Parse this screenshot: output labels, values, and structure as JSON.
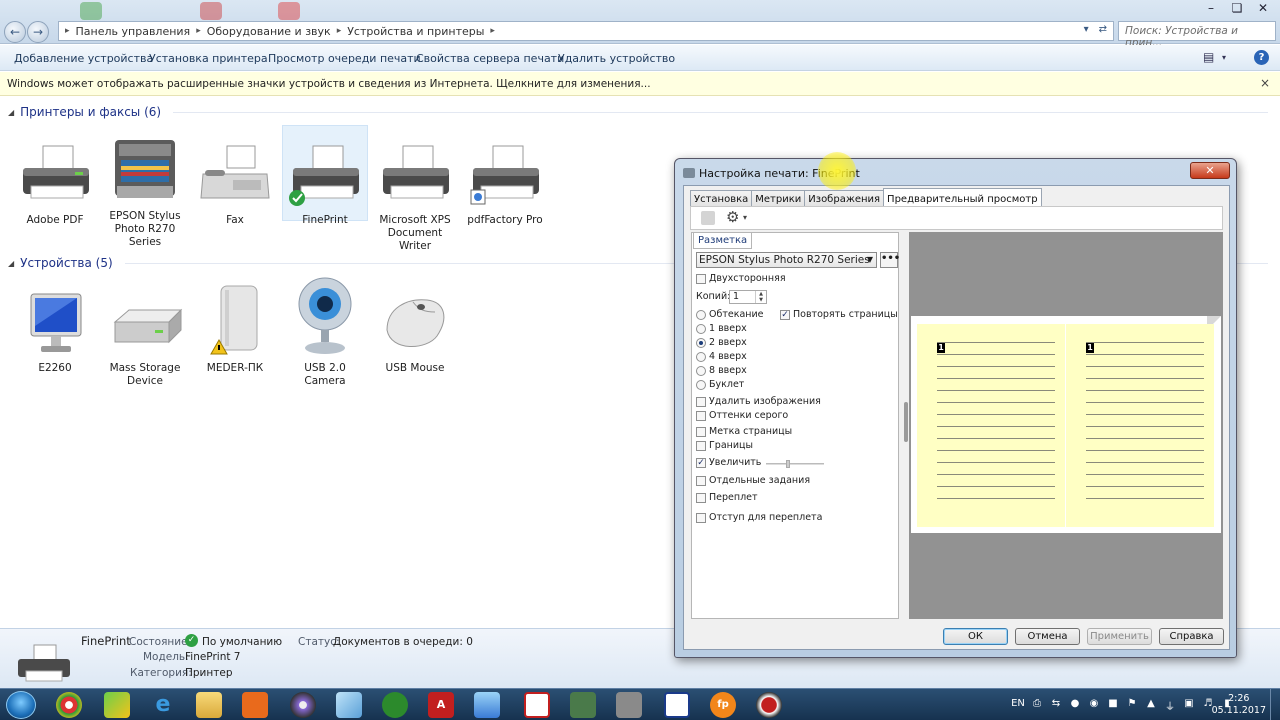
{
  "explorer": {
    "breadcrumbs": [
      "Панель управления",
      "Оборудование и звук",
      "Устройства и принтеры"
    ],
    "search_placeholder": "Поиск: Устройства и прин...",
    "toolbar": [
      "Добавление устройства",
      "Установка принтера",
      "Просмотр очереди печати",
      "Свойства сервера печати",
      "Удалить устройство"
    ],
    "infobar": "Windows может отображать расширенные значки устройств и сведения из Интернета.  Щелкните для изменения..."
  },
  "printers_group": {
    "title": "Принтеры и факсы (6)",
    "items": [
      {
        "label": "Adobe PDF",
        "icon": "printer-icon"
      },
      {
        "label": "EPSON Stylus Photo R270 Series",
        "icon": "inkjet-printer-icon"
      },
      {
        "label": "Fax",
        "icon": "fax-icon"
      },
      {
        "label": "FinePrint",
        "icon": "printer-icon",
        "selected": true,
        "default": true
      },
      {
        "label": "Microsoft XPS Document Writer",
        "icon": "printer-icon"
      },
      {
        "label": "pdfFactory Pro",
        "icon": "printer-icon"
      }
    ]
  },
  "devices_group": {
    "title": "Устройства (5)",
    "items": [
      {
        "label": "E2260",
        "icon": "monitor-icon"
      },
      {
        "label": "Mass Storage Device",
        "icon": "drive-icon"
      },
      {
        "label": "MEDER-ПК",
        "icon": "computer-tower-icon"
      },
      {
        "label": "USB 2.0 Camera",
        "icon": "webcam-icon"
      },
      {
        "label": "USB Mouse",
        "icon": "mouse-icon"
      }
    ]
  },
  "status": {
    "name": "FinePrint",
    "state_label": "Состояние:",
    "state_value": "По умолчанию",
    "status_label": "Статус:",
    "status_value": "Документов в очереди: 0",
    "model_label": "Модель:",
    "model_value": "FinePrint 7",
    "category_label": "Категория:",
    "category_value": "Принтер"
  },
  "dialog": {
    "title": "Настройка печати: FinePrint",
    "tabs": [
      "Установка",
      "Метрики",
      "Изображения",
      "Предварительный просмотр"
    ],
    "active_tab": "Предварительный просмотр",
    "layout_tab": "Разметка",
    "printer": "EPSON Stylus Photo R270 Series",
    "more_button": "•••",
    "duplex": "Двухсторонняя",
    "copies_label": "Копий:",
    "copies_value": "1",
    "layouts": [
      "Обтекание",
      "1 вверх",
      "2 вверх",
      "4 вверх",
      "8 вверх",
      "Буклет"
    ],
    "selected_layout": "2 вверх",
    "repeat_pages": "Повторять страницы",
    "options": [
      {
        "label": "Удалить изображения",
        "checked": false
      },
      {
        "label": "Оттенки серого",
        "checked": false
      },
      {
        "label": "Метка страницы",
        "checked": false
      },
      {
        "label": "Границы",
        "checked": false
      },
      {
        "label": "Увеличить",
        "checked": true
      },
      {
        "label": "Отдельные задания",
        "checked": false
      },
      {
        "label": "Переплет",
        "checked": false
      },
      {
        "label": "Отступ для переплета",
        "checked": false
      }
    ],
    "preview_page_numbers": [
      "1",
      "1"
    ],
    "buttons": {
      "ok": "ОК",
      "cancel": "Отмена",
      "apply": "Применить",
      "help": "Справка"
    }
  },
  "taskbar": {
    "lang": "EN",
    "time": "2:26",
    "date": "05.11.2017"
  },
  "colors": {
    "accent": "#1e3287",
    "info_bg": "#ffffe1",
    "preview_page": "#ffffc4",
    "default_check": "#2ea043"
  }
}
